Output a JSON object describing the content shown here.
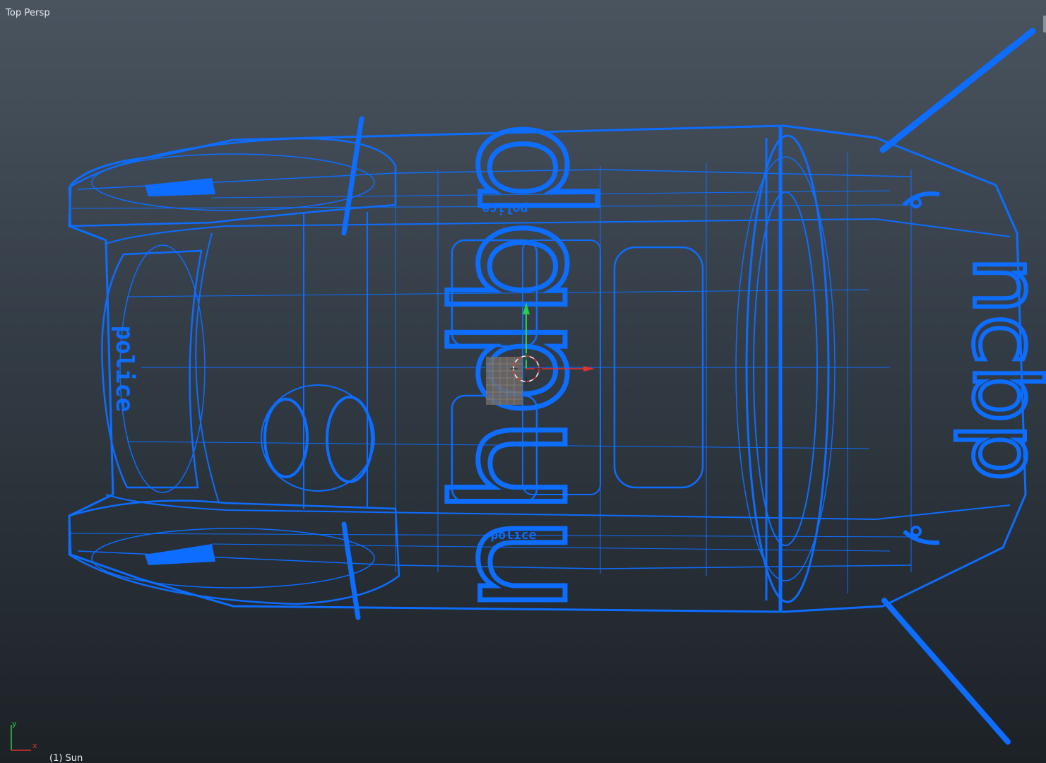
{
  "viewport": {
    "view_label": "Top Persp",
    "object_label": "(1) Sun",
    "wire_color": "#0d6dff",
    "background_top": "#4a545f",
    "background_bottom": "#1c2126"
  },
  "gizmo": {
    "y_label": "y",
    "x_label": "x",
    "y_color": "#2ecc40",
    "x_color": "#e03030"
  },
  "scene_object": {
    "kind": "wireframe-vehicle-mesh",
    "selected": true,
    "decal_texts": [
      "nhdbp",
      "ncbp",
      "police",
      "police",
      "police"
    ]
  }
}
